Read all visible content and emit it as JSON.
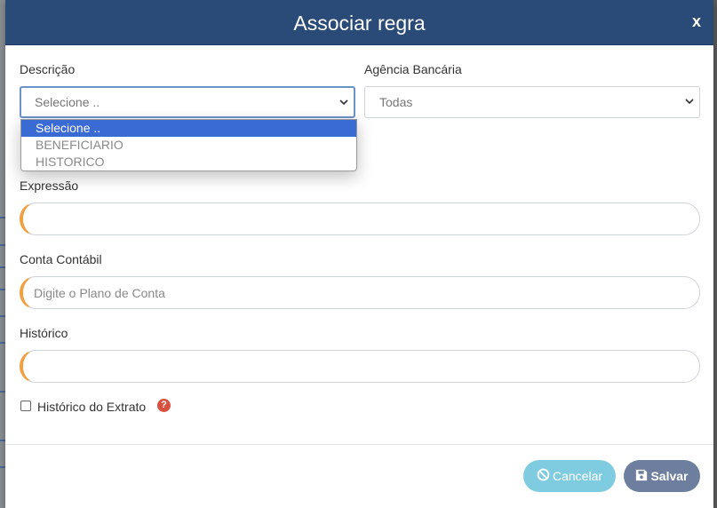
{
  "modal": {
    "title": "Associar regra",
    "close_label": "x"
  },
  "form": {
    "descricao": {
      "label": "Descrição",
      "value": "Selecione ..",
      "options": [
        "Selecione ..",
        "BENEFICIARIO",
        "HISTORICO"
      ]
    },
    "agencia": {
      "label": "Agência Bancária",
      "value": "Todas"
    },
    "expressao": {
      "label": "Expressão",
      "value": "",
      "placeholder": ""
    },
    "conta_contabil": {
      "label": "Conta Contábil",
      "value": "",
      "placeholder": "Digite o Plano de Conta"
    },
    "historico": {
      "label": "Histórico",
      "value": "",
      "placeholder": ""
    },
    "historico_extrato": {
      "label": "Histórico do Extrato",
      "checked": false,
      "help_glyph": "?"
    }
  },
  "footer": {
    "cancel_label": "Cancelar",
    "save_label": "Salvar"
  },
  "colors": {
    "header": "#2a4a78",
    "accent_border": "#f0a040",
    "cancel_button": "#7fcbe0",
    "save_button": "#6e7e9e",
    "selected_option": "#3a6ad4",
    "help_icon": "#d9503f"
  },
  "icons": {
    "cancel": "ban-icon",
    "save": "floppy-disk-icon",
    "help": "question-circle-icon"
  }
}
